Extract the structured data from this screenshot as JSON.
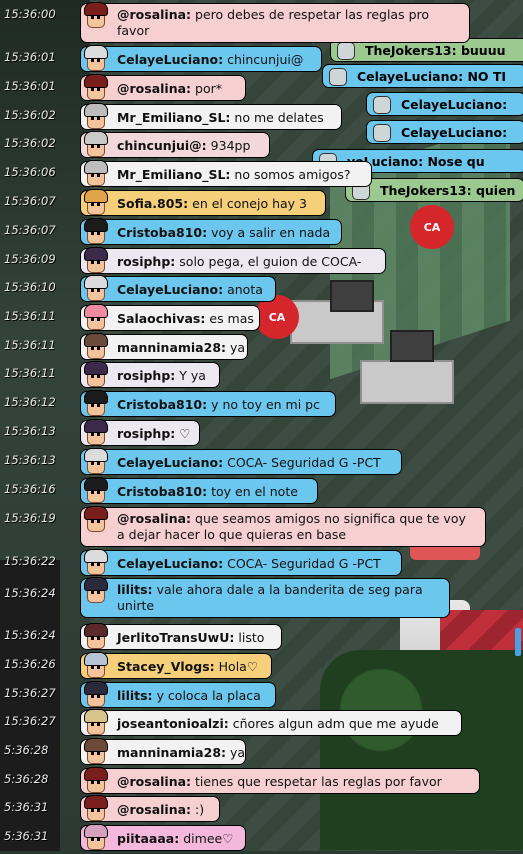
{
  "theme": {
    "red": "#f6cfd0",
    "blue": "#6cc7ee",
    "white": "#f2f2f2",
    "gold": "#f6cf7a",
    "magenta": "#f3b8dc",
    "ghost_green": "#9bc98f"
  },
  "ghost_lines": [
    {
      "text": "TheJokers13: buuuu",
      "color": "green"
    },
    {
      "text": "CelayeLuciano: NO TI",
      "color": "blue"
    },
    {
      "text": "CelayeLuciano:",
      "color": "blue"
    },
    {
      "text": "CelayeLuciano:",
      "color": "blue"
    },
    {
      "text": "yeLuciano: Nose qu",
      "color": "blue"
    },
    {
      "text": "TheJokers13: quien",
      "color": "green"
    }
  ],
  "messages": [
    {
      "time": "15:36:00",
      "user": "@rosalina:",
      "text": "pero debes de respetar las reglas pro favor",
      "color": "red",
      "avatar": "rosalina-avatar-icon"
    },
    {
      "time": "15:36:01",
      "user": "CelayeLuciano:",
      "text": "chincunjui@",
      "color": "blue",
      "avatar": "celaye-avatar-icon"
    },
    {
      "time": "15:36:01",
      "user": "@rosalina:",
      "text": "por*",
      "color": "red",
      "avatar": "rosalina-avatar-icon"
    },
    {
      "time": "15:36:02",
      "user": "Mr_Emiliano_SL:",
      "text": "no me delates",
      "color": "white",
      "avatar": "emiliano-avatar-icon"
    },
    {
      "time": "15:36:02",
      "user": "chincunjui@:",
      "text": "934pp",
      "color": "pink",
      "avatar": "chincunjui-avatar-icon"
    },
    {
      "time": "15:36:06",
      "user": "Mr_Emiliano_SL:",
      "text": "no somos amigos?",
      "color": "white",
      "avatar": "emiliano-avatar-icon"
    },
    {
      "time": "15:36:07",
      "user": "Sofia.805:",
      "text": "en el conejo hay 3",
      "color": "gold",
      "avatar": "sofia-avatar-icon"
    },
    {
      "time": "15:36:07",
      "user": "Cristoba810:",
      "text": "voy a salir en nada",
      "color": "blue",
      "avatar": "cristoba-avatar-icon"
    },
    {
      "time": "15:36:09",
      "user": "rosiphp:",
      "text": "solo pega, el guion de COCA-",
      "color": "purple",
      "avatar": "rosiphp-avatar-icon"
    },
    {
      "time": "15:36:10",
      "user": "CelayeLuciano:",
      "text": "anota",
      "color": "blue",
      "avatar": "celaye-avatar-icon"
    },
    {
      "time": "15:36:11",
      "user": "Salaochivas:",
      "text": "es mas",
      "color": "white",
      "avatar": "salaochivas-avatar-icon"
    },
    {
      "time": "15:36:11",
      "user": "manninamia28:",
      "text": "ya",
      "color": "white",
      "avatar": "manninamia-avatar-icon"
    },
    {
      "time": "15:36:11",
      "user": "rosiphp:",
      "text": "Y ya",
      "color": "purple",
      "avatar": "rosiphp-avatar-icon"
    },
    {
      "time": "15:36:12",
      "user": "Cristoba810:",
      "text": "y no toy en mi pc",
      "color": "blue",
      "avatar": "cristoba-avatar-icon"
    },
    {
      "time": "15:36:13",
      "user": "rosiphp:",
      "text": "♡",
      "color": "purple",
      "avatar": "rosiphp-avatar-icon"
    },
    {
      "time": "15:36:13",
      "user": "CelayeLuciano:",
      "text": "COCA- Seguridad G -PCT",
      "color": "blue",
      "avatar": "celaye-avatar-icon"
    },
    {
      "time": "15:36:16",
      "user": "Cristoba810:",
      "text": "toy en el note",
      "color": "blue",
      "avatar": "cristoba-avatar-icon"
    },
    {
      "time": "15:36:19",
      "user": "@rosalina:",
      "text": "que seamos amigos no significa que te voy a dejar hacer lo que quieras en base",
      "color": "red",
      "avatar": "rosalina-avatar-icon"
    },
    {
      "time": "15:36:22",
      "user": "CelayeLuciano:",
      "text": "COCA- Seguridad G -PCT",
      "color": "blue",
      "avatar": "celaye-avatar-icon"
    },
    {
      "time": "15:36:24",
      "user": "lilits:",
      "text": "vale ahora dale a la banderita de seg para unirte",
      "color": "blue",
      "avatar": "lilits-avatar-icon"
    },
    {
      "time": "15:36:24",
      "user": "JerlitoTransUwU:",
      "text": "listo",
      "color": "white",
      "avatar": "jerlito-avatar-icon"
    },
    {
      "time": "15:36:26",
      "user": "Stacey_Vlogs:",
      "text": "Hola♡",
      "color": "gold",
      "avatar": "stacey-avatar-icon"
    },
    {
      "time": "15:36:27",
      "user": "lilits:",
      "text": "y coloca la placa",
      "color": "blue",
      "avatar": "lilits-avatar-icon"
    },
    {
      "time": "15:36:27",
      "user": "joseantonioalzi:",
      "text": "cñores algun adm que me ayude",
      "color": "white",
      "avatar": "jose-avatar-icon"
    },
    {
      "time": "5:36:28",
      "user": "manninamia28:",
      "text": "ya",
      "color": "white",
      "avatar": "manninamia-avatar-icon"
    },
    {
      "time": "5:36:28",
      "user": "@rosalina:",
      "text": "tienes que respetar las reglas por favor",
      "color": "red",
      "avatar": "rosalina-avatar-icon"
    },
    {
      "time": "5:36:31",
      "user": "@rosalina:",
      "text": ":)",
      "color": "red",
      "avatar": "rosalina-avatar-icon"
    },
    {
      "time": "5:36:31",
      "user": "piitaaaa:",
      "text": "dimee♡",
      "color": "magenta",
      "avatar": "piitaaaa-avatar-icon"
    }
  ]
}
